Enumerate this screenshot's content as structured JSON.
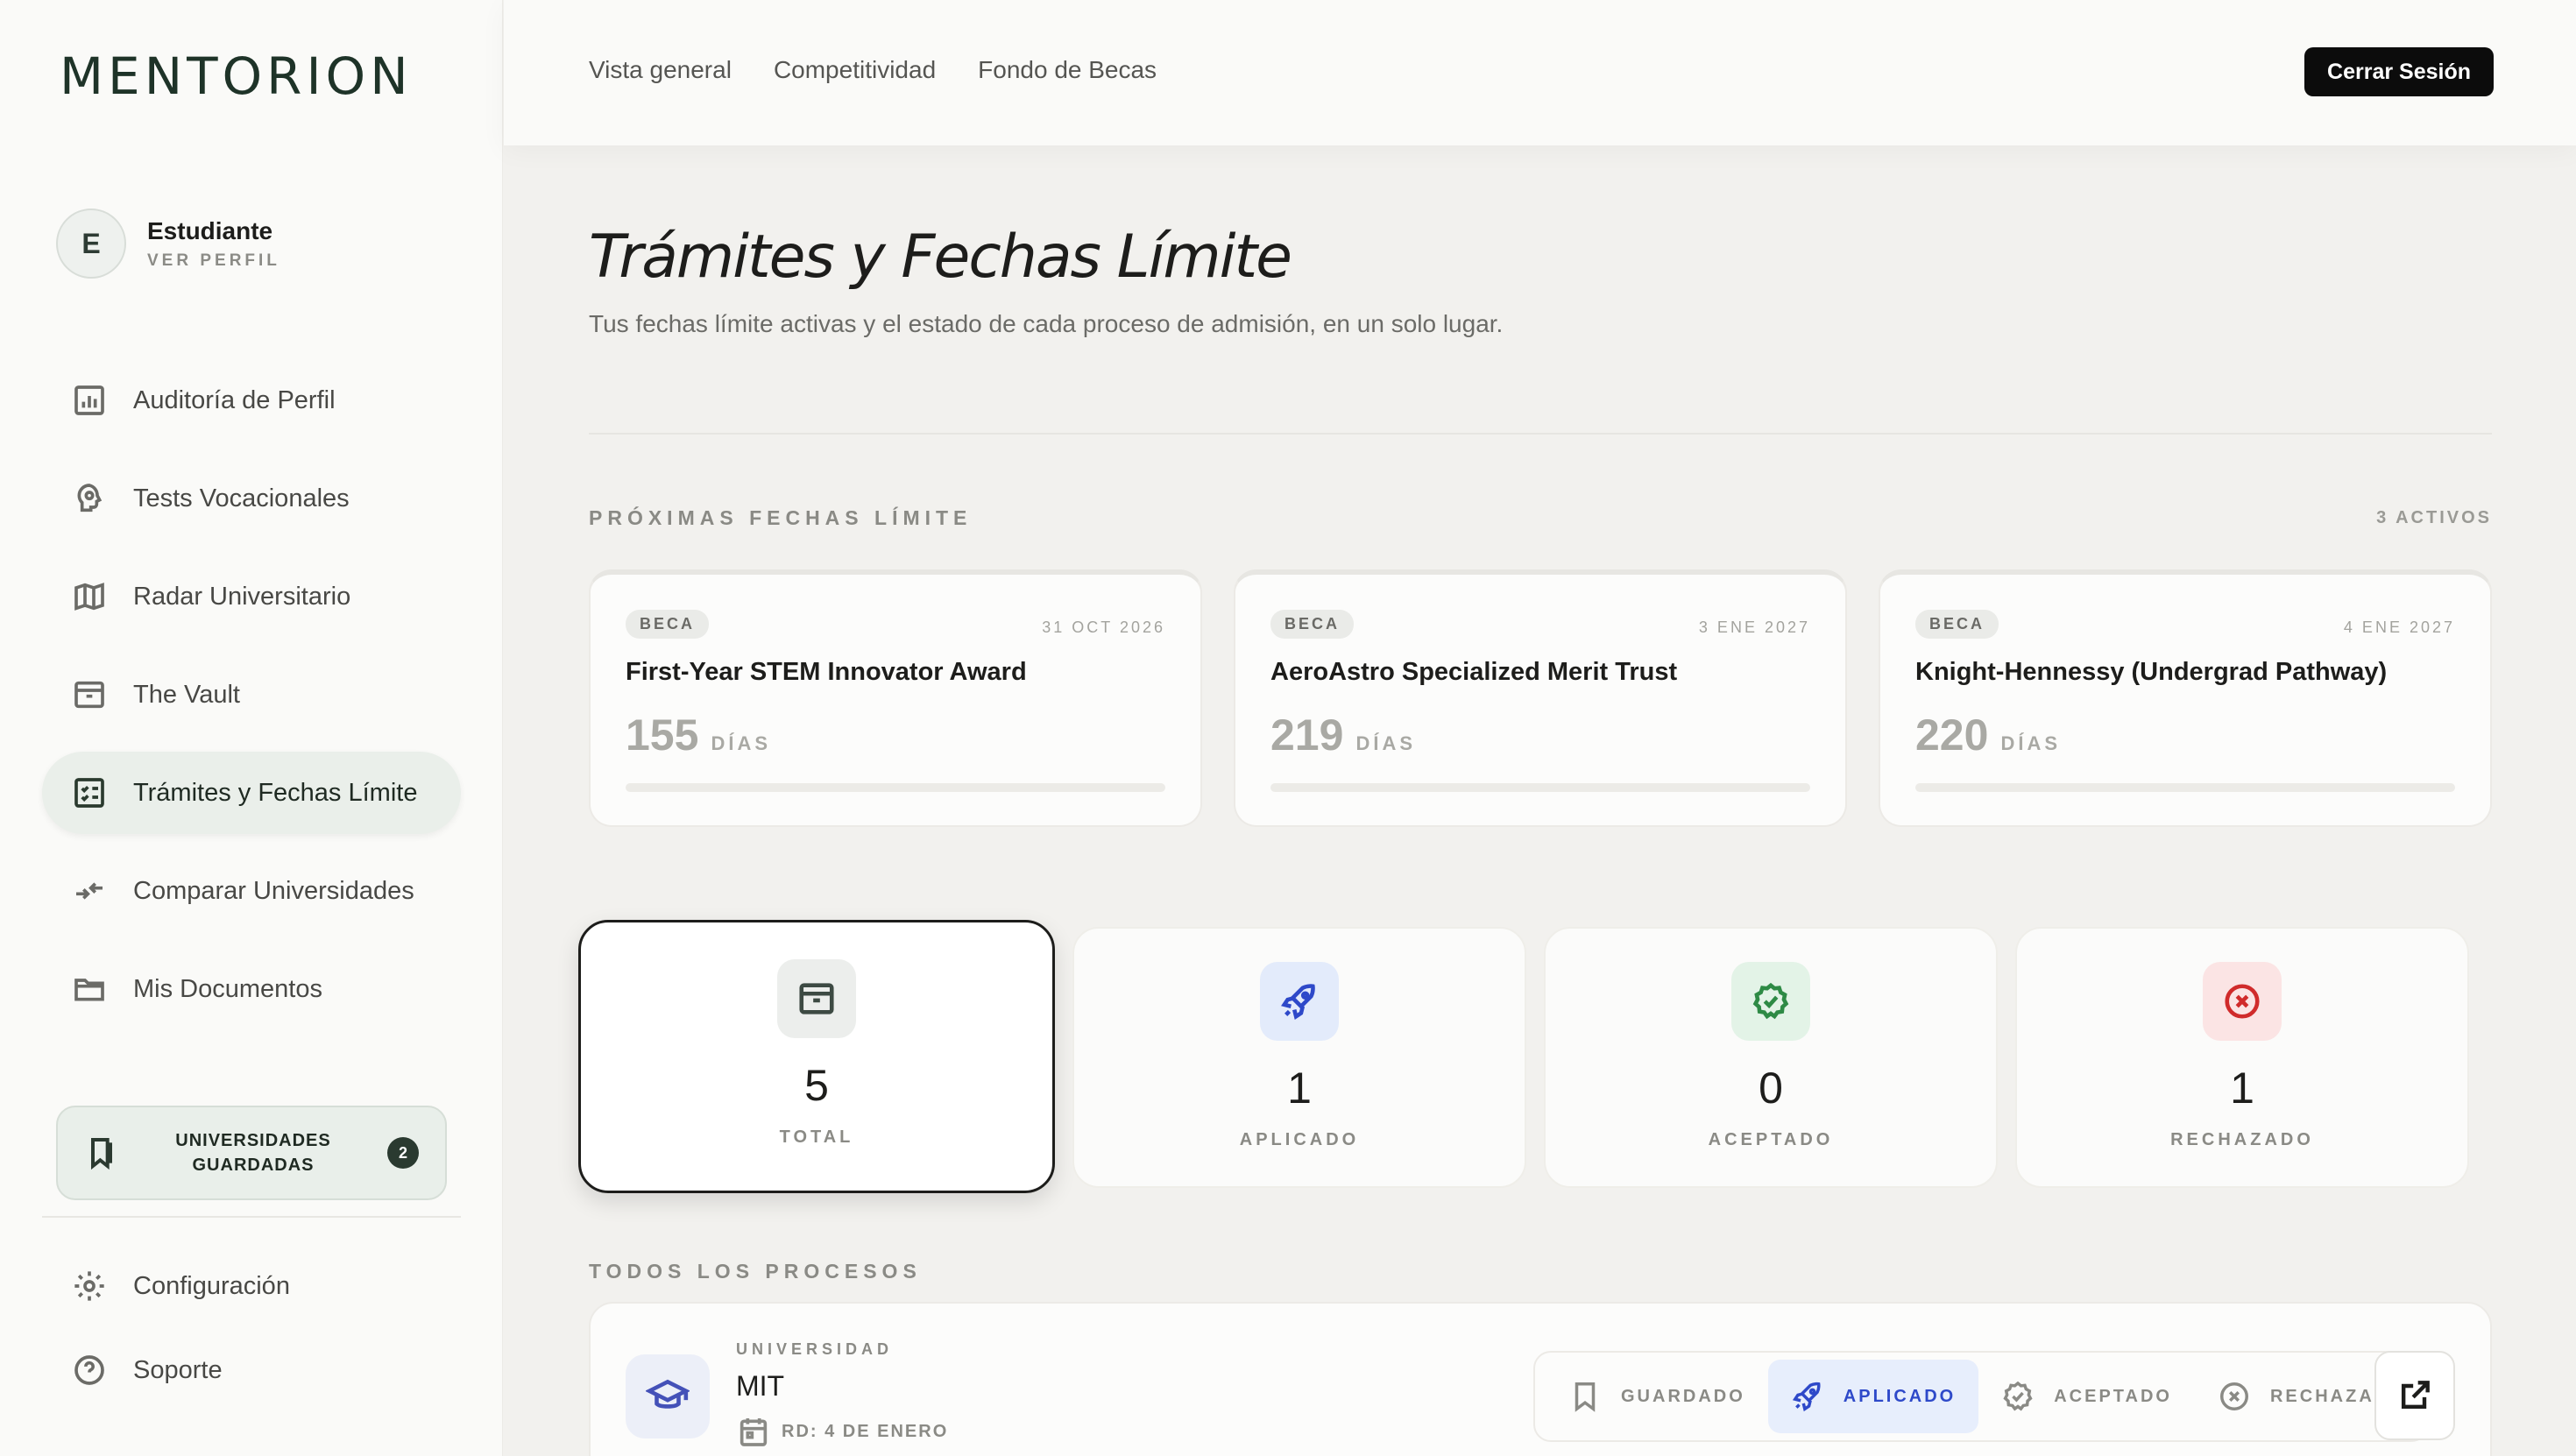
{
  "brand": {
    "logo": "MENTORION"
  },
  "profile": {
    "initial": "E",
    "name": "Estudiante",
    "link": "VER PERFIL"
  },
  "sidebar": {
    "items": [
      {
        "label": "Auditoría de Perfil",
        "icon": "chart-icon"
      },
      {
        "label": "Tests Vocacionales",
        "icon": "brain-icon"
      },
      {
        "label": "Radar Universitario",
        "icon": "map-icon"
      },
      {
        "label": "The Vault",
        "icon": "archive-icon"
      },
      {
        "label": "Trámites y Fechas Límite",
        "icon": "checklist-icon",
        "active": true
      },
      {
        "label": "Comparar Universidades",
        "icon": "compare-arrows-icon"
      },
      {
        "label": "Mis Documentos",
        "icon": "folder-icon"
      }
    ],
    "saved": {
      "label": "UNIVERSIDADES\nGUARDADAS",
      "count": "2"
    },
    "bottom": [
      {
        "label": "Configuración",
        "icon": "gear-icon"
      },
      {
        "label": "Soporte",
        "icon": "help-icon"
      }
    ]
  },
  "topbar": {
    "links": [
      "Vista general",
      "Competitividad",
      "Fondo de Becas"
    ],
    "logout": "Cerrar Sesión"
  },
  "page": {
    "title": "Trámites y Fechas Límite",
    "subtitle": "Tus fechas límite activas y el estado de cada proceso de admisión, en un solo lugar."
  },
  "deadlines": {
    "section": "PRÓXIMAS FECHAS LÍMITE",
    "active_count": "3 ACTIVOS",
    "items": [
      {
        "tag": "BECA",
        "date": "31 OCT 2026",
        "name": "First-Year STEM Innovator Award",
        "days": "155",
        "unit": "DÍAS",
        "progress": 0.0
      },
      {
        "tag": "BECA",
        "date": "3 ENE 2027",
        "name": "AeroAstro Specialized Merit Trust",
        "days": "219",
        "unit": "DÍAS",
        "progress": 0.0
      },
      {
        "tag": "BECA",
        "date": "4 ENE 2027",
        "name": "Knight-Hennessy (Undergrad Pathway)",
        "days": "220",
        "unit": "DÍAS",
        "progress": 0.0
      }
    ]
  },
  "stats": [
    {
      "value": "5",
      "label": "TOTAL",
      "icon": "archive-icon",
      "bg": "#eceeec",
      "color": "#3d4a43",
      "selected": true
    },
    {
      "value": "1",
      "label": "APLICADO",
      "icon": "rocket-icon",
      "bg": "#e3ebfb",
      "color": "#2e49c9"
    },
    {
      "value": "0",
      "label": "ACEPTADO",
      "icon": "verified-badge-icon",
      "bg": "#e3f3e7",
      "color": "#2e8a45"
    },
    {
      "value": "1",
      "label": "RECHAZADO",
      "icon": "x-circle-icon",
      "bg": "#fbe4e4",
      "color": "#d02b2b"
    }
  ],
  "processes": {
    "section": "TODOS LOS PROCESOS",
    "items": [
      {
        "kind": "UNIVERSIDAD",
        "name": "MIT",
        "rd": "RD: 4 DE ENERO",
        "statuses": [
          {
            "label": "GUARDADO",
            "icon": "bookmark-icon"
          },
          {
            "label": "APLICADO",
            "icon": "rocket-icon",
            "active": true
          },
          {
            "label": "ACEPTADO",
            "icon": "verified-badge-icon"
          },
          {
            "label": "RECHAZADO",
            "icon": "x-circle-icon"
          }
        ]
      }
    ]
  }
}
